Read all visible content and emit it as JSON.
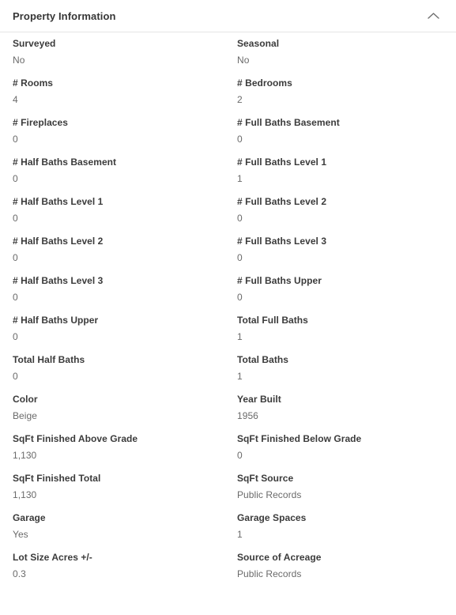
{
  "panel": {
    "title": "Property Information",
    "collapse_icon": "chevron-up-icon",
    "expanded": true
  },
  "fields": [
    {
      "label": "Surveyed",
      "value": "No"
    },
    {
      "label": "Seasonal",
      "value": "No"
    },
    {
      "label": "# Rooms",
      "value": "4"
    },
    {
      "label": "# Bedrooms",
      "value": "2"
    },
    {
      "label": "# Fireplaces",
      "value": "0"
    },
    {
      "label": "# Full Baths Basement",
      "value": "0"
    },
    {
      "label": "# Half Baths Basement",
      "value": "0"
    },
    {
      "label": "# Full Baths Level 1",
      "value": "1"
    },
    {
      "label": "# Half Baths Level 1",
      "value": "0"
    },
    {
      "label": "# Full Baths Level 2",
      "value": "0"
    },
    {
      "label": "# Half Baths Level 2",
      "value": "0"
    },
    {
      "label": "# Full Baths Level 3",
      "value": "0"
    },
    {
      "label": "# Half Baths Level 3",
      "value": "0"
    },
    {
      "label": "# Full Baths Upper",
      "value": "0"
    },
    {
      "label": "# Half Baths Upper",
      "value": "0"
    },
    {
      "label": "Total Full Baths",
      "value": "1"
    },
    {
      "label": "Total Half Baths",
      "value": "0"
    },
    {
      "label": "Total Baths",
      "value": "1"
    },
    {
      "label": "Color",
      "value": "Beige"
    },
    {
      "label": "Year Built",
      "value": "1956"
    },
    {
      "label": "SqFt Finished Above Grade",
      "value": "1,130"
    },
    {
      "label": "SqFt Finished Below Grade",
      "value": "0"
    },
    {
      "label": "SqFt Finished Total",
      "value": "1,130"
    },
    {
      "label": "SqFt Source",
      "value": "Public Records"
    },
    {
      "label": "Garage",
      "value": "Yes"
    },
    {
      "label": "Garage Spaces",
      "value": "1"
    },
    {
      "label": "Lot Size Acres +/-",
      "value": "0.3"
    },
    {
      "label": "Source of Acreage",
      "value": "Public Records"
    }
  ],
  "colors": {
    "background": "#ffffff",
    "label_text": "#3b3b3b",
    "value_text": "#6a6a6a",
    "title_text": "#363636",
    "divider": "#e4e4e4"
  }
}
